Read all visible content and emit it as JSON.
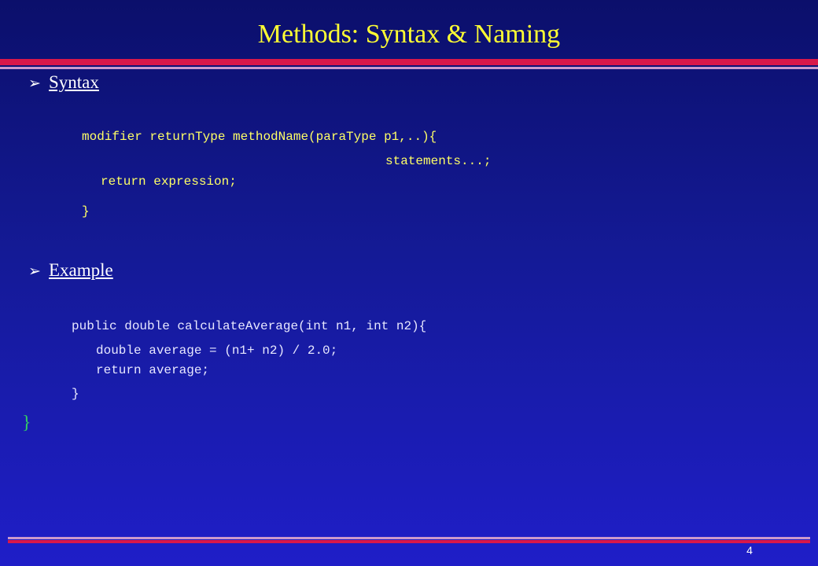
{
  "slide": {
    "title": "Methods: Syntax & Naming",
    "page_number": "4"
  },
  "colors": {
    "background_top": "#0b0f6b",
    "background_bottom": "#1f1ec8",
    "title": "#ffff33",
    "accent_red": "#d9184a",
    "accent_pink": "#cc99cc",
    "code": "#ffff66",
    "stray_brace": "#33cc66"
  },
  "bullets": {
    "arrow_symbol": "➢",
    "syntax": {
      "label": "Syntax",
      "code_signature": "modifier returnType methodName(paraType p1,..){",
      "code_statements": "statements...;",
      "code_return": "return expression;",
      "code_close": "}"
    },
    "example": {
      "label": "Example",
      "code_signature": "public double calculateAverage(int n1, int n2){",
      "code_line1": "double average = (n1+ n2) / 2.0;",
      "code_line2": "return average;",
      "code_close": "}",
      "stray_brace": "}"
    }
  }
}
